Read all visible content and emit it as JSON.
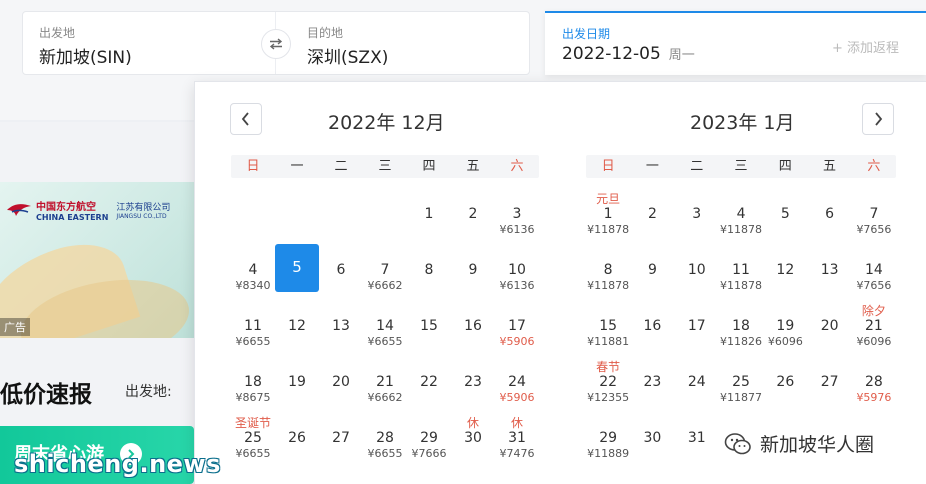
{
  "search": {
    "from": {
      "label": "出发地",
      "value": "新加坡(SIN)"
    },
    "to": {
      "label": "目的地",
      "value": "深圳(SZX)"
    },
    "depart": {
      "label": "出发日期",
      "value": "2022-12-05",
      "weekday": "周一"
    },
    "add_return": "+ 添加返程",
    "accent": "#1e8ae8"
  },
  "ad": {
    "airline_cn": "中国东方航空",
    "airline_en": "CHINA EASTERN",
    "branch_cn": "江苏有限公司",
    "branch_en": "JIANGSU CO.,LTD",
    "tag": "广告"
  },
  "deals": {
    "title": "低价速报",
    "from_label": "出发地:",
    "weekend_label": "周末省心游"
  },
  "calendar": {
    "weekdays": [
      "日",
      "一",
      "二",
      "三",
      "四",
      "五",
      "六"
    ],
    "months": [
      {
        "title": "2022年 12月",
        "first_weekday": 4,
        "days": [
          {
            "d": "1",
            "p": ""
          },
          {
            "d": "2",
            "p": ""
          },
          {
            "d": "3",
            "p": "¥6136"
          },
          {
            "d": "4",
            "p": "¥8340"
          },
          {
            "d": "5",
            "p": "",
            "selected": true
          },
          {
            "d": "6",
            "p": ""
          },
          {
            "d": "7",
            "p": "¥6662"
          },
          {
            "d": "8",
            "p": ""
          },
          {
            "d": "9",
            "p": ""
          },
          {
            "d": "10",
            "p": "¥6136"
          },
          {
            "d": "11",
            "p": "¥6655"
          },
          {
            "d": "12",
            "p": ""
          },
          {
            "d": "13",
            "p": ""
          },
          {
            "d": "14",
            "p": "¥6655"
          },
          {
            "d": "15",
            "p": ""
          },
          {
            "d": "16",
            "p": ""
          },
          {
            "d": "17",
            "p": "¥5906",
            "low": true
          },
          {
            "d": "18",
            "p": "¥8675"
          },
          {
            "d": "19",
            "p": ""
          },
          {
            "d": "20",
            "p": ""
          },
          {
            "d": "21",
            "p": "¥6662"
          },
          {
            "d": "22",
            "p": ""
          },
          {
            "d": "23",
            "p": ""
          },
          {
            "d": "24",
            "p": "¥5906",
            "low": true
          },
          {
            "d": "25",
            "p": "¥6655",
            "h": "圣诞节"
          },
          {
            "d": "26",
            "p": ""
          },
          {
            "d": "27",
            "p": ""
          },
          {
            "d": "28",
            "p": "¥6655"
          },
          {
            "d": "29",
            "p": "¥7666"
          },
          {
            "d": "30",
            "p": "",
            "h": "休"
          },
          {
            "d": "31",
            "p": "¥7476",
            "h": "休"
          }
        ]
      },
      {
        "title": "2023年 1月",
        "first_weekday": 0,
        "days": [
          {
            "d": "1",
            "p": "¥11878",
            "h": "元旦"
          },
          {
            "d": "2",
            "p": ""
          },
          {
            "d": "3",
            "p": ""
          },
          {
            "d": "4",
            "p": "¥11878"
          },
          {
            "d": "5",
            "p": ""
          },
          {
            "d": "6",
            "p": ""
          },
          {
            "d": "7",
            "p": "¥7656"
          },
          {
            "d": "8",
            "p": "¥11878"
          },
          {
            "d": "9",
            "p": ""
          },
          {
            "d": "10",
            "p": ""
          },
          {
            "d": "11",
            "p": "¥11878"
          },
          {
            "d": "12",
            "p": ""
          },
          {
            "d": "13",
            "p": ""
          },
          {
            "d": "14",
            "p": "¥7656"
          },
          {
            "d": "15",
            "p": "¥11881"
          },
          {
            "d": "16",
            "p": ""
          },
          {
            "d": "17",
            "p": ""
          },
          {
            "d": "18",
            "p": "¥11826"
          },
          {
            "d": "19",
            "p": "¥6096"
          },
          {
            "d": "20",
            "p": ""
          },
          {
            "d": "21",
            "p": "¥6096",
            "h": "除夕"
          },
          {
            "d": "22",
            "p": "¥12355",
            "h": "春节"
          },
          {
            "d": "23",
            "p": ""
          },
          {
            "d": "24",
            "p": ""
          },
          {
            "d": "25",
            "p": "¥11877"
          },
          {
            "d": "26",
            "p": ""
          },
          {
            "d": "27",
            "p": ""
          },
          {
            "d": "28",
            "p": "¥5976",
            "low": true
          },
          {
            "d": "29",
            "p": "¥11889"
          },
          {
            "d": "30",
            "p": ""
          },
          {
            "d": "31",
            "p": ""
          }
        ]
      }
    ]
  },
  "watermarks": {
    "left": "shicheng.news",
    "right": "新加坡华人圈"
  }
}
